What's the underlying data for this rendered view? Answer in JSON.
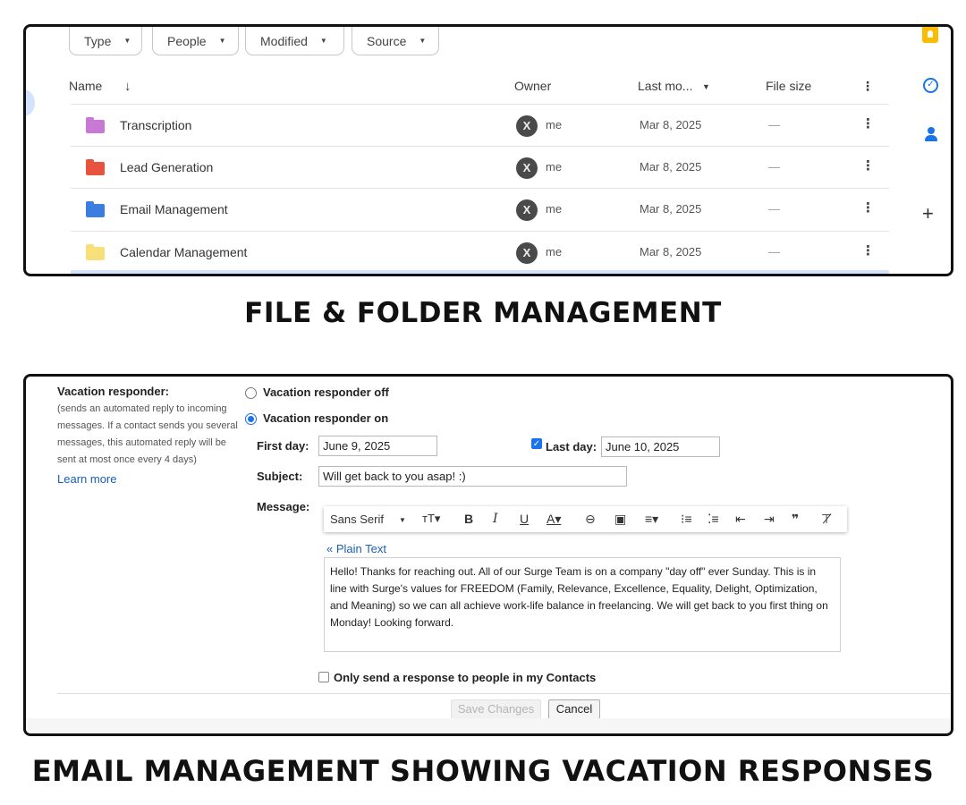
{
  "drive": {
    "filters": [
      {
        "label": "Type"
      },
      {
        "label": "People"
      },
      {
        "label": "Modified"
      },
      {
        "label": "Source"
      }
    ],
    "columns": {
      "name": "Name",
      "owner": "Owner",
      "last_modified": "Last mo...",
      "file_size": "File size"
    },
    "rows": [
      {
        "name": "Transcription",
        "owner": "me",
        "modified": "Mar 8, 2025",
        "size": "—",
        "color": "#c879d6"
      },
      {
        "name": "Lead Generation",
        "owner": "me",
        "modified": "Mar 8, 2025",
        "size": "—",
        "color": "#e8533f"
      },
      {
        "name": "Email Management",
        "owner": "me",
        "modified": "Mar 8, 2025",
        "size": "—",
        "color": "#3b7de0"
      },
      {
        "name": "Calendar Management",
        "owner": "me",
        "modified": "Mar 8, 2025",
        "size": "—",
        "color": "#f7e07a"
      }
    ],
    "side_icons": [
      "keep-icon",
      "tasks-icon",
      "contacts-icon",
      "add-icon"
    ],
    "avatar_letter": "X"
  },
  "captions": {
    "top": "FILE & FOLDER MANAGEMENT",
    "bottom": "EMAIL MANAGEMENT SHOWING VACATION RESPONSES"
  },
  "vacation": {
    "title": "Vacation responder:",
    "description": "(sends an automated reply to incoming messages. If a contact sends you several messages, this automated reply will be sent at most once every 4 days)",
    "learn_more": "Learn more",
    "option_off": "Vacation responder off",
    "option_on": "Vacation responder on",
    "first_day_label": "First day:",
    "first_day_value": "June 9, 2025",
    "last_day_label": "Last day:",
    "last_day_value": "June 10, 2025",
    "subject_label": "Subject:",
    "subject_value": "Will get back to you asap! :)",
    "message_label": "Message:",
    "font_name": "Sans Serif",
    "plain_text_link": "« Plain Text",
    "message_body": "Hello! Thanks for reaching out. All of our Surge Team is on a company \"day off\" ever Sunday. This is in line with Surge's values for FREEDOM (Family, Relevance, Excellence, Equality, Delight, Optimization, and Meaning) so we can all achieve work-life balance in freelancing. We will get back to you first thing on Monday! Looking forward.",
    "contacts_only": "Only send a response to people in my Contacts",
    "save_button": "Save Changes",
    "cancel_button": "Cancel"
  }
}
